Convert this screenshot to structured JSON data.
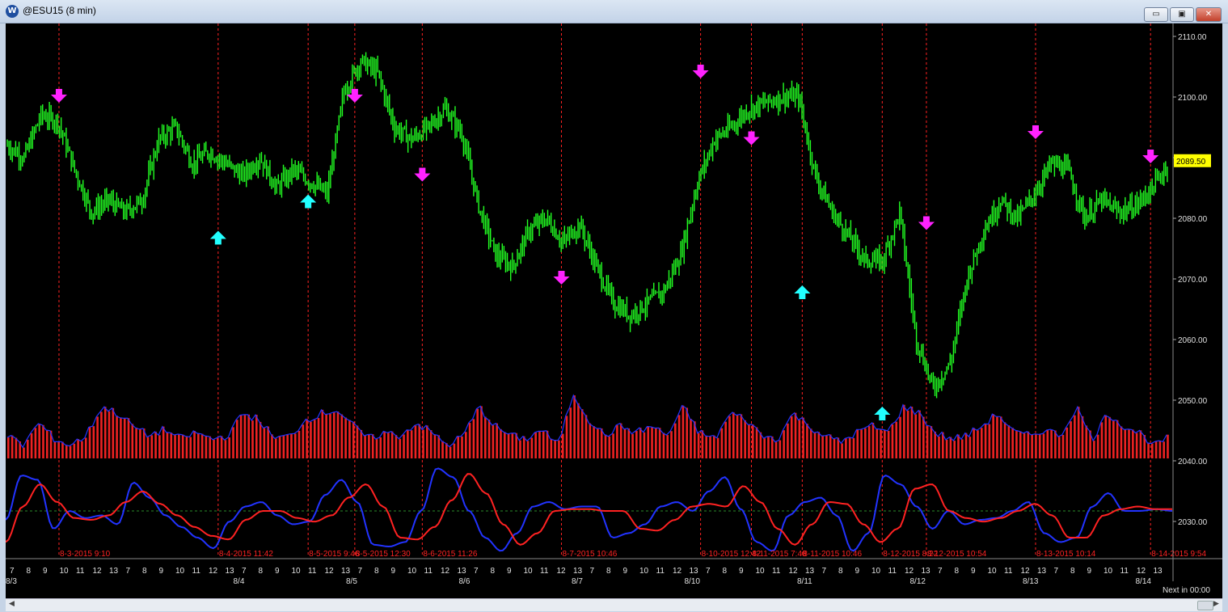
{
  "window": {
    "title": "@ESU15 (8 min)",
    "icon": "W",
    "buttons": {
      "minimize": "▭",
      "maximize": "▣",
      "close": "✕"
    }
  },
  "colors": {
    "background": "#000000",
    "price_bars": "#22ff22",
    "down_arrow": "#ff22ff",
    "up_arrow": "#22ffff",
    "volume_bars": "#ee2222",
    "volume_line": "#2233ff",
    "osc_fast": "#2233ff",
    "osc_slow": "#ff2222",
    "vertical_markers": "#ff2222",
    "last_price_bg": "#ffff00",
    "axis_text": "#e0e0e0"
  },
  "chart_data": {
    "type": "bar",
    "y_axis": {
      "ticks": [
        "2110.00",
        "2100.00",
        "2090.00",
        "2080.00",
        "2070.00",
        "2060.00",
        "2050.00",
        "2040.00",
        "2030.00"
      ],
      "tick_values": [
        2110,
        2100,
        2090,
        2080,
        2070,
        2060,
        2050,
        2040,
        2030
      ],
      "last_price": "2089.50",
      "last_price_value": 2089.5
    },
    "x_axis": {
      "hour_labels": [
        "7",
        "8",
        "9",
        "10",
        "11",
        "12",
        "13",
        "7",
        "8",
        "9",
        "10",
        "11",
        "12",
        "13",
        "7",
        "8",
        "9",
        "10",
        "11",
        "12",
        "13",
        "7",
        "8",
        "9",
        "10",
        "11",
        "12",
        "13",
        "7",
        "8",
        "9",
        "10",
        "11",
        "12",
        "13",
        "7",
        "8",
        "9",
        "10",
        "11",
        "12",
        "13",
        "7",
        "8",
        "9",
        "10",
        "11",
        "12",
        "13",
        "7",
        "8",
        "9",
        "10",
        "11",
        "12",
        "13",
        "7",
        "8",
        "9",
        "10",
        "11",
        "12",
        "13",
        "7",
        "8",
        "9",
        "10",
        "11",
        "12",
        "13"
      ],
      "date_labels": [
        "8/3",
        "8/4",
        "8/5",
        "8/6",
        "8/7",
        "8/10",
        "8/11",
        "8/12",
        "8/13",
        "8/14"
      ],
      "footer": "Next in 00:00"
    },
    "price_path": [
      2092,
      2090,
      2097,
      2096,
      2088,
      2081,
      2083,
      2081,
      2083,
      2093,
      2095,
      2089,
      2091,
      2089,
      2087,
      2090,
      2085,
      2088,
      2086,
      2084,
      2101,
      2106,
      2104,
      2095,
      2093,
      2095,
      2098,
      2094,
      2082,
      2074,
      2072,
      2078,
      2080,
      2076,
      2079,
      2072,
      2066,
      2064,
      2066,
      2068,
      2074,
      2086,
      2093,
      2095,
      2098,
      2099,
      2100,
      2100,
      2087,
      2081,
      2077,
      2073,
      2073,
      2081,
      2060,
      2052,
      2056,
      2070,
      2078,
      2083,
      2080,
      2084,
      2089,
      2088,
      2080,
      2083,
      2081,
      2082,
      2085,
      2089
    ],
    "down_arrows": [
      {
        "pos": 0.064,
        "price": 2100
      },
      {
        "pos": 0.419,
        "price": 2100
      },
      {
        "pos": 0.5,
        "price": 2087
      },
      {
        "pos": 0.667,
        "price": 2070
      },
      {
        "pos": 0.834,
        "price": 2104
      },
      {
        "pos": 0.895,
        "price": 2093
      },
      {
        "pos": 1.105,
        "price": 2079
      },
      {
        "pos": 1.236,
        "price": 2094
      },
      {
        "pos": 1.374,
        "price": 2090
      }
    ],
    "up_arrows": [
      {
        "pos": 0.255,
        "price": 2077
      },
      {
        "pos": 0.363,
        "price": 2083
      },
      {
        "pos": 0.956,
        "price": 2068
      },
      {
        "pos": 1.052,
        "price": 2048
      }
    ],
    "markers": [
      {
        "label": "8-3-2015 9:10",
        "pos": 0.064
      },
      {
        "label": "8-4-2015 11:42",
        "pos": 0.255
      },
      {
        "label": "8-5-2015 9:46",
        "pos": 0.363
      },
      {
        "label": "8-5-2015 12:30",
        "pos": 0.419
      },
      {
        "label": "8-6-2015 11:26",
        "pos": 0.5
      },
      {
        "label": "8-7-2015 10:46",
        "pos": 0.667
      },
      {
        "label": "8-10-2015 12:42",
        "pos": 0.834
      },
      {
        "label": "8-11-2015 7:48",
        "pos": 0.895
      },
      {
        "label": "8-11-2015 10:46",
        "pos": 0.956
      },
      {
        "label": "8-12-2015 8:22",
        "pos": 1.052
      },
      {
        "label": "8-12-2015 10:54",
        "pos": 1.105
      },
      {
        "label": "8-13-2015 10:14",
        "pos": 1.236
      },
      {
        "label": "8-14-2015 9:54",
        "pos": 1.374
      }
    ],
    "volume_profile": [
      0.35,
      0.2,
      0.55,
      0.3,
      0.2,
      0.35,
      0.8,
      0.7,
      0.5,
      0.35,
      0.45,
      0.3,
      0.4,
      0.3,
      0.35,
      0.7,
      0.6,
      0.3,
      0.35,
      0.6,
      0.7,
      0.75,
      0.5,
      0.3,
      0.4,
      0.35,
      0.55,
      0.4,
      0.2,
      0.35,
      0.8,
      0.5,
      0.35,
      0.3,
      0.45,
      0.2,
      1.0,
      0.6,
      0.35,
      0.5,
      0.4,
      0.5,
      0.35,
      0.8,
      0.4,
      0.3,
      0.7,
      0.6,
      0.35,
      0.3,
      0.7,
      0.5,
      0.35,
      0.25,
      0.4,
      0.5,
      0.4,
      0.8,
      0.7,
      0.4,
      0.3,
      0.35,
      0.5,
      0.7,
      0.4,
      0.35,
      0.45,
      0.35,
      0.8,
      0.3,
      0.7,
      0.5,
      0.4,
      0.2,
      0.35
    ],
    "oscillator": {
      "fast": [
        0.4,
        0.9,
        0.85,
        0.3,
        0.5,
        0.42,
        0.45,
        0.35,
        0.82,
        0.65,
        0.45,
        0.32,
        0.2,
        0.08,
        0.38,
        0.55,
        0.6,
        0.45,
        0.35,
        0.38,
        0.68,
        0.85,
        0.6,
        0.12,
        0.1,
        0.15,
        0.5,
        0.98,
        0.88,
        0.5,
        0.2,
        0.05,
        0.25,
        0.55,
        0.6,
        0.52,
        0.55,
        0.55,
        0.2,
        0.25,
        0.35,
        0.55,
        0.6,
        0.5,
        0.72,
        0.88,
        0.52,
        0.15,
        0.05,
        0.45,
        0.6,
        0.65,
        0.45,
        0.05,
        0.25,
        0.9,
        0.8,
        0.55,
        0.3,
        0.5,
        0.35,
        0.4,
        0.42,
        0.5,
        0.6,
        0.25,
        0.15,
        0.2,
        0.55,
        0.7,
        0.5,
        0.5,
        0.52,
        0.5
      ],
      "slow": [
        0.15,
        0.55,
        0.8,
        0.6,
        0.42,
        0.4,
        0.45,
        0.6,
        0.72,
        0.58,
        0.45,
        0.32,
        0.22,
        0.18,
        0.4,
        0.5,
        0.5,
        0.42,
        0.38,
        0.45,
        0.65,
        0.8,
        0.55,
        0.2,
        0.18,
        0.32,
        0.62,
        0.92,
        0.7,
        0.35,
        0.12,
        0.25,
        0.5,
        0.52,
        0.52,
        0.5,
        0.5,
        0.3,
        0.28,
        0.4,
        0.55,
        0.58,
        0.55,
        0.78,
        0.6,
        0.3,
        0.12,
        0.35,
        0.6,
        0.58,
        0.35,
        0.15,
        0.3,
        0.75,
        0.8,
        0.5,
        0.42,
        0.38,
        0.42,
        0.5,
        0.58,
        0.45,
        0.2,
        0.2,
        0.45,
        0.52,
        0.55,
        0.52,
        0.52
      ],
      "zero_level": 0.5
    }
  }
}
